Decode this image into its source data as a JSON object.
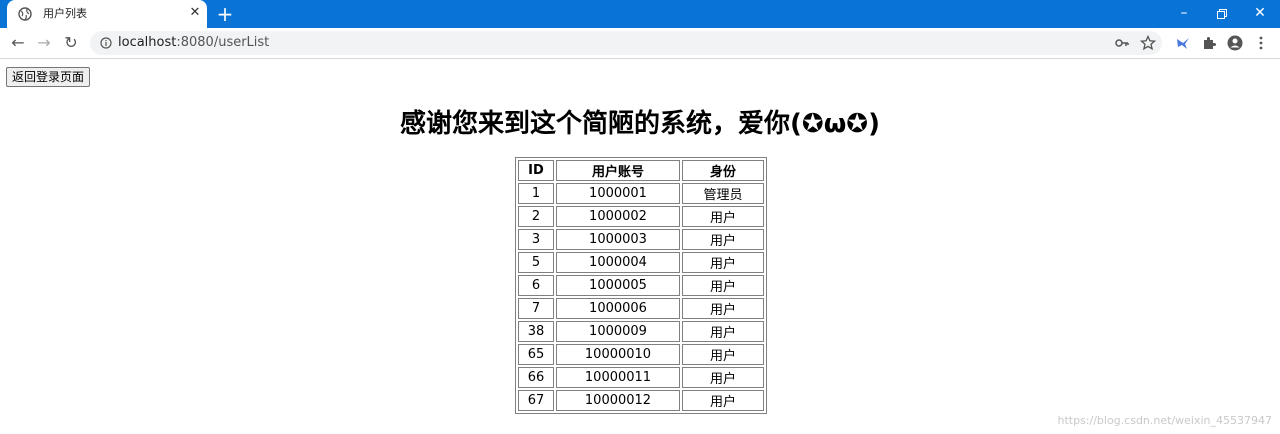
{
  "browser": {
    "tab_title": "用户列表",
    "url_host": "localhost",
    "url_rest": ":8080/userList"
  },
  "page": {
    "back_button": "返回登录页面",
    "heading": "感谢您来到这个简陋的系统，爱你(✪ω✪)",
    "table": {
      "headers": [
        "ID",
        "用户账号",
        "身份"
      ],
      "rows": [
        [
          "1",
          "1000001",
          "管理员"
        ],
        [
          "2",
          "1000002",
          "用户"
        ],
        [
          "3",
          "1000003",
          "用户"
        ],
        [
          "5",
          "1000004",
          "用户"
        ],
        [
          "6",
          "1000005",
          "用户"
        ],
        [
          "7",
          "1000006",
          "用户"
        ],
        [
          "38",
          "1000009",
          "用户"
        ],
        [
          "65",
          "10000010",
          "用户"
        ],
        [
          "66",
          "10000011",
          "用户"
        ],
        [
          "67",
          "10000012",
          "用户"
        ]
      ]
    },
    "watermark": "https://blog.csdn.net/weixin_45537947"
  },
  "colors": {
    "titlebar": "#0a74d6",
    "omnibox": "#f1f3f4"
  },
  "icons": [
    "globe-icon",
    "close-icon",
    "plus-icon",
    "minimize-icon",
    "restore-icon",
    "window-close-icon",
    "back-arrow-icon",
    "forward-arrow-icon",
    "reload-icon",
    "info-icon",
    "key-icon",
    "star-icon",
    "extension-bird-icon",
    "puzzle-icon",
    "account-icon",
    "menu-dots-icon"
  ]
}
